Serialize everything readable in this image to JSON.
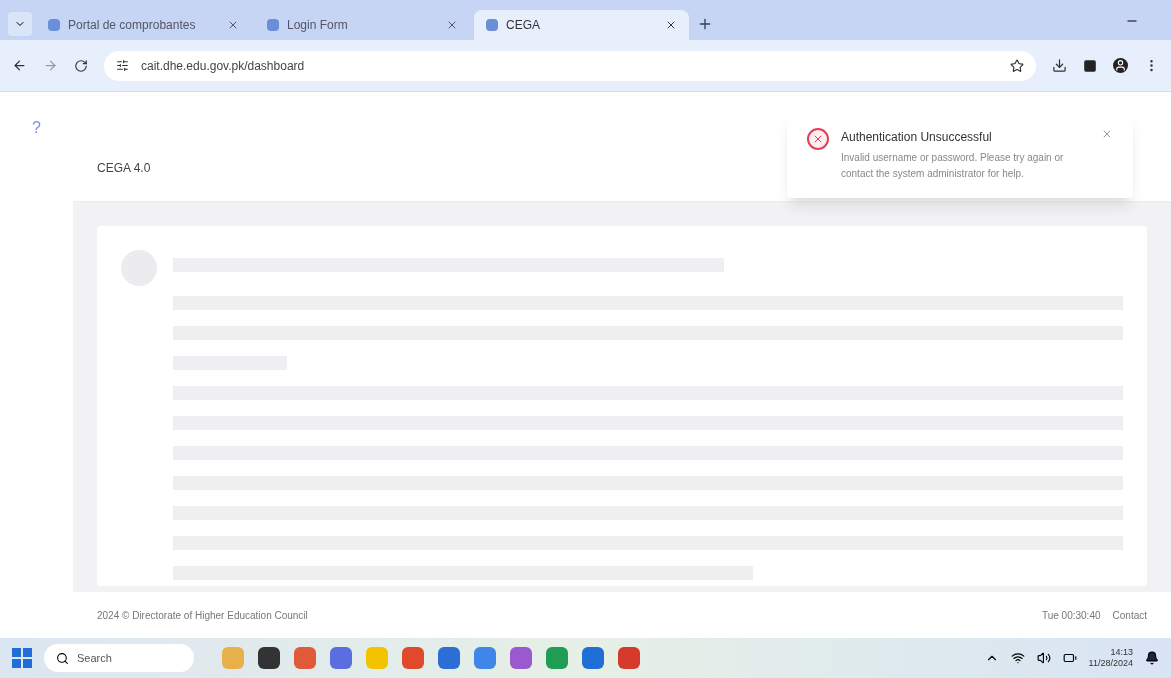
{
  "browser": {
    "tabs": [
      {
        "title": "Portal de comprobantes",
        "selected": false
      },
      {
        "title": "Login Form",
        "selected": false
      },
      {
        "title": "CEGA",
        "selected": true
      }
    ],
    "url": "cait.dhe.edu.gov.pk/dashboard"
  },
  "page": {
    "help_icon": "?",
    "header_title": "CEGA 4.0"
  },
  "toast": {
    "title": "Authentication Unsuccessful",
    "message": "Invalid username or password. Please try again or contact the system administrator for help."
  },
  "footer": {
    "copyright": "2024 © Directorate of Higher Education Council",
    "time": "Tue 00:30:40",
    "link": "Contact"
  },
  "taskbar": {
    "search_placeholder": "Search",
    "time": "14:13",
    "date": "11/28/2024"
  }
}
